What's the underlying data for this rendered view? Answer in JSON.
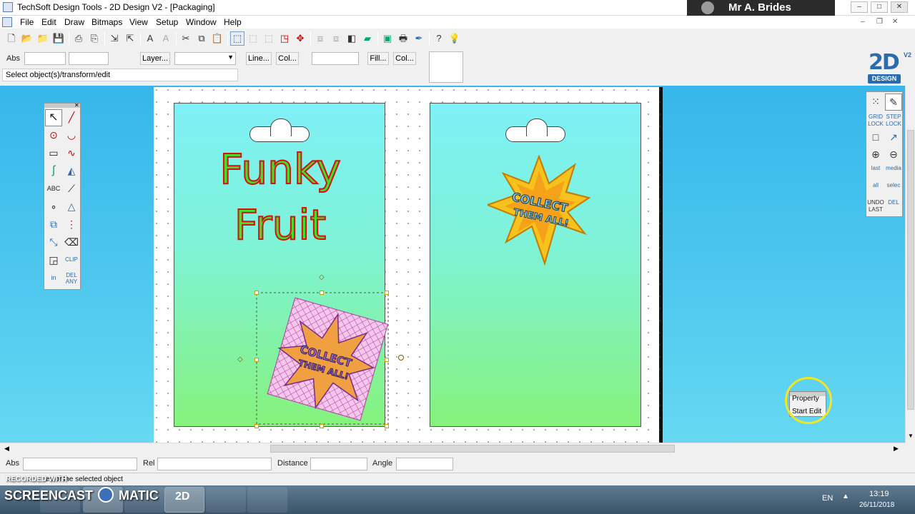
{
  "window": {
    "title": "TechSoft Design Tools - 2D Design V2 - [Packaging]",
    "user_name": "Mr A. Brides",
    "minimize": "–",
    "maximize": "□",
    "close": "✕"
  },
  "menu": [
    "File",
    "Edit",
    "Draw",
    "Bitmaps",
    "View",
    "Setup",
    "Window",
    "Help"
  ],
  "property_bar": {
    "abs_label": "Abs",
    "layer_button": "Layer...",
    "line_button": "Line...",
    "line_col_button": "Col...",
    "fill_button": "Fill...",
    "fill_col_button": "Col..."
  },
  "status_hint": "Select object(s)/transform/edit",
  "logo": {
    "big": "2D",
    "small": "DESIGN",
    "super": "V2"
  },
  "panels": {
    "left_title_line1": "Funky",
    "left_title_line2": "Fruit",
    "starburst_text_line1": "COLLECT",
    "starburst_text_line2": "THEM ALL!"
  },
  "left_toolbox": [
    {
      "name": "select-arrow-icon",
      "glyph": "↖"
    },
    {
      "name": "line-tool-icon",
      "glyph": "╱"
    },
    {
      "name": "circle-tool-icon",
      "glyph": "⊙"
    },
    {
      "name": "arc-tool-icon",
      "glyph": "◡"
    },
    {
      "name": "rectangle-tool-icon",
      "glyph": "▭"
    },
    {
      "name": "curve-tool-icon",
      "glyph": "∿"
    },
    {
      "name": "spline-tool-icon",
      "glyph": "ʃ"
    },
    {
      "name": "hatch-tool-icon",
      "glyph": "◭"
    },
    {
      "name": "text-tool-icon",
      "glyph": "ABC"
    },
    {
      "name": "measure-tool-icon",
      "glyph": "⟋"
    },
    {
      "name": "points-tool-icon",
      "glyph": "∘"
    },
    {
      "name": "triangle-tool-icon",
      "glyph": "△"
    },
    {
      "name": "group-tool-icon",
      "glyph": "⧉"
    },
    {
      "name": "align-tool-icon",
      "glyph": "⋮"
    },
    {
      "name": "node-edit-icon",
      "glyph": "⤡"
    },
    {
      "name": "erase-tool-icon",
      "glyph": "⌫"
    },
    {
      "name": "trim-tool-icon",
      "glyph": "◲"
    },
    {
      "name": "clip-tool-icon",
      "glyph": "CLIP"
    },
    {
      "name": "in-tool-icon",
      "glyph": "in"
    },
    {
      "name": "delete-any-icon",
      "glyph": "DEL ANY"
    }
  ],
  "right_tools": [
    {
      "name": "grid-icon",
      "label": "⁙"
    },
    {
      "name": "pen-icon",
      "label": "✎"
    },
    {
      "name": "grid-lock-icon",
      "label": "GRID LOCK"
    },
    {
      "name": "step-lock-icon",
      "label": "STEP LOCK"
    },
    {
      "name": "frame-icon",
      "label": "□"
    },
    {
      "name": "axis-icon",
      "label": "↗"
    },
    {
      "name": "zoom-in-icon",
      "label": "⊕"
    },
    {
      "name": "zoom-out-icon",
      "label": "⊖"
    },
    {
      "name": "last-icon",
      "label": "last"
    },
    {
      "name": "media-icon",
      "label": "media"
    },
    {
      "name": "all-icon",
      "label": "all"
    },
    {
      "name": "select-icon",
      "label": "selec"
    },
    {
      "name": "undo-last-icon",
      "label": "UNDO LAST"
    },
    {
      "name": "del-icon",
      "label": "DEL"
    }
  ],
  "popup": {
    "item1": "Property",
    "item2": "Start Edit"
  },
  "bottom_bar": {
    "abs_label": "Abs",
    "rel_label": "Rel",
    "distance_label": "Distance",
    "angle_label": "Angle"
  },
  "status_bar_text": "es of the selected object",
  "watermark": {
    "recorded_with": "RECORDED WITH",
    "brand": "SCREENCAST",
    "brand2": "MATIC"
  },
  "tray": {
    "lang": "EN",
    "time": "13:19",
    "date": "26/11/2018"
  }
}
